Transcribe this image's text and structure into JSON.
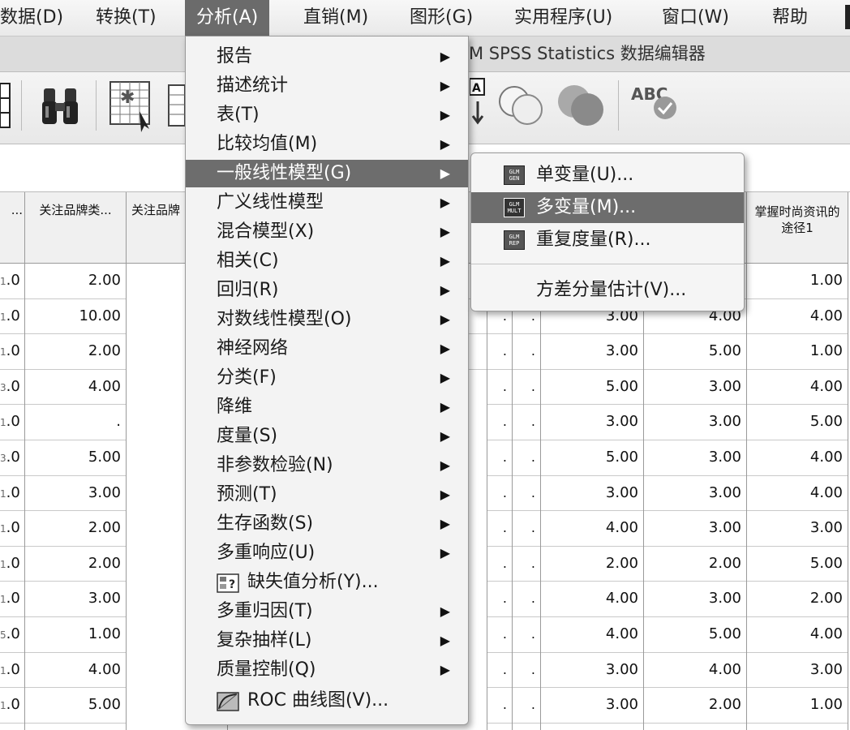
{
  "menubar": {
    "items": [
      "数据(D)",
      "转换(T)",
      "分析(A)",
      "直销(M)",
      "图形(G)",
      "实用程序(U)",
      "窗口(W)",
      "帮助"
    ],
    "active_index": 2
  },
  "window_title": "M SPSS Statistics 数据编辑器",
  "toolbar": {
    "icons": [
      "table-icon",
      "binoculars-icon",
      "grid-select-icon",
      "table-icon",
      "value-labels-icon",
      "venn-outline-icon",
      "venn-filled-icon",
      "spellcheck-icon"
    ],
    "spellcheck_text": "ABC"
  },
  "analyze_menu": {
    "items": [
      {
        "label": "报告",
        "submenu": true
      },
      {
        "label": "描述统计",
        "submenu": true
      },
      {
        "label": "表(T)",
        "submenu": true
      },
      {
        "label": "比较均值(M)",
        "submenu": true
      },
      {
        "label": "一般线性模型(G)",
        "submenu": true,
        "highlighted": true
      },
      {
        "label": "广义线性模型",
        "submenu": true
      },
      {
        "label": "混合模型(X)",
        "submenu": true
      },
      {
        "label": "相关(C)",
        "submenu": true
      },
      {
        "label": "回归(R)",
        "submenu": true
      },
      {
        "label": "对数线性模型(O)",
        "submenu": true
      },
      {
        "label": "神经网络",
        "submenu": true
      },
      {
        "label": "分类(F)",
        "submenu": true
      },
      {
        "label": "降维",
        "submenu": true
      },
      {
        "label": "度量(S)",
        "submenu": true
      },
      {
        "label": "非参数检验(N)",
        "submenu": true
      },
      {
        "label": "预测(T)",
        "submenu": true
      },
      {
        "label": "生存函数(S)",
        "submenu": true
      },
      {
        "label": "多重响应(U)",
        "submenu": true
      },
      {
        "label": "缺失值分析(Y)...",
        "submenu": false,
        "icon": "missing-value-icon"
      },
      {
        "label": "多重归因(T)",
        "submenu": true
      },
      {
        "label": "复杂抽样(L)",
        "submenu": true
      },
      {
        "label": "质量控制(Q)",
        "submenu": true
      },
      {
        "label": "ROC 曲线图(V)...",
        "submenu": false,
        "icon": "roc-curve-icon"
      }
    ],
    "arrow_glyph": "▶"
  },
  "glm_submenu": {
    "items": [
      {
        "label": "单变量(U)...",
        "icon_text": [
          "GLM",
          "GEN"
        ]
      },
      {
        "label": "多变量(M)...",
        "icon_text": [
          "GLM",
          "MULT"
        ],
        "highlighted": true
      },
      {
        "label": "重复度量(R)...",
        "icon_text": [
          "GLM",
          "REP"
        ]
      },
      {
        "label": "方差分量估计(V)..."
      }
    ]
  },
  "grid": {
    "col_a": {
      "header": "...",
      "cells": [
        ".0",
        ".0",
        ".0",
        ".0",
        ".0",
        ".0",
        ".0",
        ".0",
        ".0",
        ".0",
        ".0",
        ".0",
        ".0"
      ],
      "prefix_glyphs": [
        "1",
        "1",
        "1",
        "3",
        "1",
        "3",
        "1",
        "1",
        "1",
        "1",
        "5",
        "1",
        "1"
      ]
    },
    "col_b": {
      "header": "关注品牌类...",
      "cells": [
        "2.00",
        "10.00",
        "2.00",
        "4.00",
        ".",
        "5.00",
        "3.00",
        "2.00",
        "2.00",
        "3.00",
        "1.00",
        "4.00",
        "5.00"
      ]
    },
    "col_c": {
      "header": "关注品牌",
      "cells": [
        "",
        "",
        "",
        "",
        "",
        "",
        "",
        "",
        "",
        "",
        "",
        "",
        ""
      ]
    },
    "dots": ".",
    "col_d": {
      "header": "",
      "cells": [
        "",
        "3.00",
        "3.00",
        "5.00",
        "3.00",
        "5.00",
        "3.00",
        "4.00",
        "2.00",
        "4.00",
        "4.00",
        "3.00",
        "3.00"
      ]
    },
    "col_e": {
      "header": "",
      "cells": [
        "",
        "4.00",
        "5.00",
        "3.00",
        "3.00",
        "3.00",
        "3.00",
        "3.00",
        "2.00",
        "3.00",
        "5.00",
        "4.00",
        "2.00"
      ]
    },
    "col_f": {
      "header": "掌握时尚资讯的途径1",
      "cells": [
        "1.00",
        "4.00",
        "1.00",
        "4.00",
        "5.00",
        "4.00",
        "4.00",
        "3.00",
        "5.00",
        "2.00",
        "4.00",
        "3.00",
        "1.00"
      ]
    }
  }
}
